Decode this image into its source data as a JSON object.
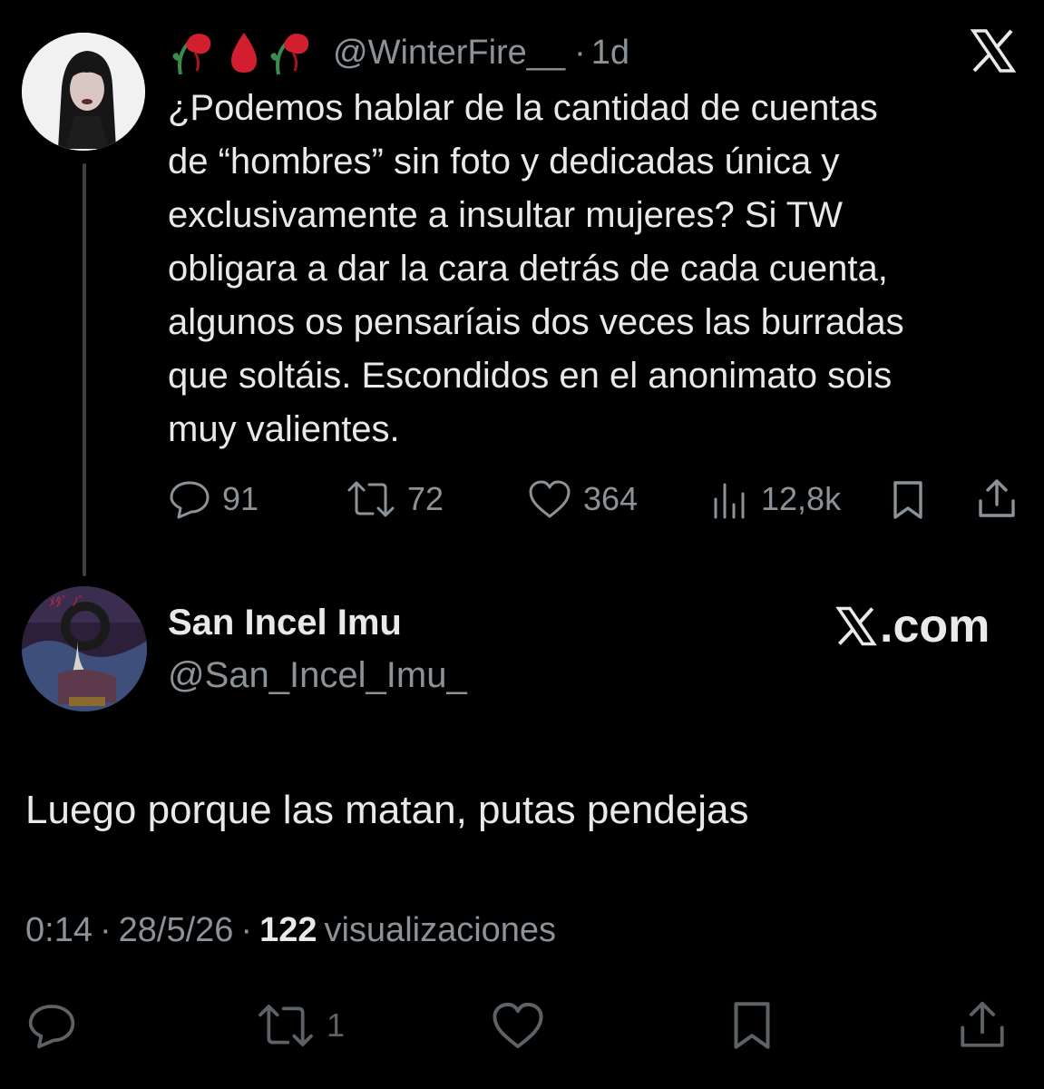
{
  "original_tweet": {
    "emojis": [
      "wilted-rose-emoji",
      "drop-of-blood-emoji",
      "wilted-rose-emoji"
    ],
    "handle": "@WinterFire__",
    "separator": "·",
    "time_ago": "1d",
    "text": "¿Podemos hablar de la cantidad de cuentas\nde “hombres” sin foto y dedicadas única y\nexclusivamente a insultar mujeres? Si TW\nobligara a dar la cara detrás de cada cuenta,\nalgunos os pensaríais dos veces las burradas\nque soltáis. Escondidos en el anonimato sois\nmuy valientes.",
    "metrics": {
      "replies": "91",
      "reposts": "72",
      "likes": "364",
      "views": "12,8k"
    }
  },
  "reply_tweet": {
    "name": "San Incel Imu",
    "handle": "@San_Incel_Imu_",
    "watermark": ".com",
    "text": "Luego porque las matan, putas pendejas",
    "time": "0:14",
    "date": "28/5/26",
    "sep1": "·",
    "sep2": "·",
    "views_count": "122",
    "views_label": "visualizaciones",
    "reposts": "1"
  },
  "colors": {
    "background": "#000000",
    "text": "#e7e9ea",
    "secondary": "#8b9298",
    "thread_line": "#3e4144",
    "emoji_red": "#d21f2f"
  }
}
